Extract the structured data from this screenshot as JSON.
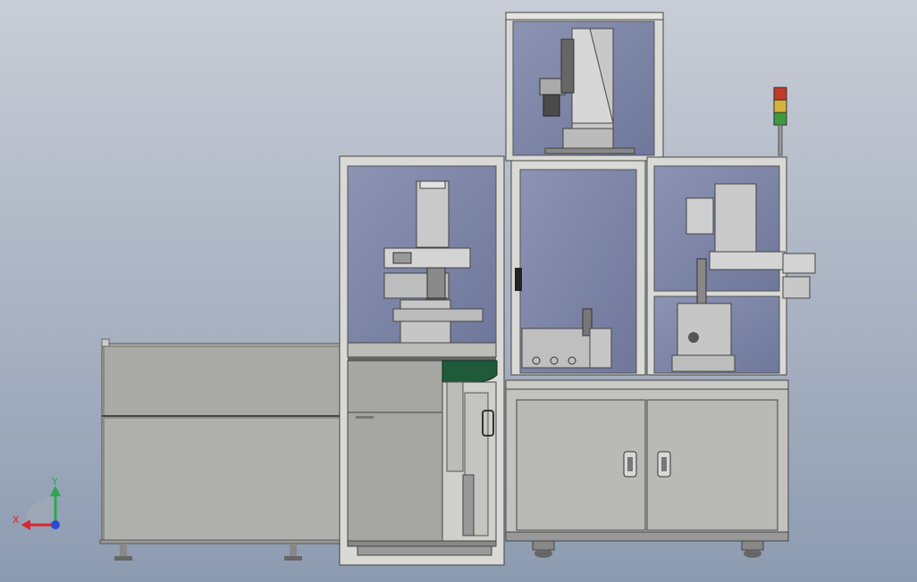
{
  "viewport": {
    "background_top": "#c9cdd6",
    "background_bottom": "#8d9bb1"
  },
  "colors": {
    "frame": "#d8d8d4",
    "frame_edge": "#4a4a4a",
    "glass": "#7e86a8",
    "panel_gray": "#a7a7a3",
    "cabinet": "#b9b9b5",
    "conveyor_green": "#1f5a3a",
    "light_red": "#c23a2a",
    "light_yellow": "#d7b23a",
    "light_green": "#3f9a3f"
  },
  "triad": {
    "x_label": "X",
    "y_label": "Y",
    "x_color": "#d8282a",
    "y_color": "#2ca84a",
    "z_color": "#2c49d8"
  },
  "icons": {
    "cabinet_handle": "cabinet-handle-icon",
    "signal_tower": "signal-tower-icon"
  }
}
